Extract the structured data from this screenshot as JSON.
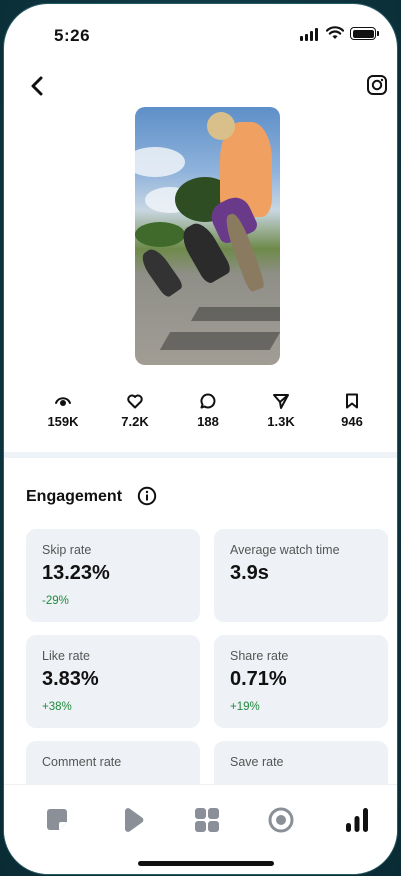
{
  "status": {
    "time": "5:26"
  },
  "header": {
    "back_icon": "chevron-left-icon",
    "platform_icon": "instagram-icon"
  },
  "stats": [
    {
      "icon": "eye-icon",
      "value": "159K"
    },
    {
      "icon": "heart-icon",
      "value": "7.2K"
    },
    {
      "icon": "comment-icon",
      "value": "188"
    },
    {
      "icon": "share-icon",
      "value": "1.3K"
    },
    {
      "icon": "bookmark-icon",
      "value": "946"
    }
  ],
  "engagement": {
    "title": "Engagement",
    "cards": [
      {
        "label": "Skip rate",
        "value": "13.23%",
        "change": "-29%"
      },
      {
        "label": "Average watch time",
        "value": "3.9s",
        "change": ""
      },
      {
        "label": "Like rate",
        "value": "3.83%",
        "change": "+38%"
      },
      {
        "label": "Share rate",
        "value": "0.71%",
        "change": "+19%"
      },
      {
        "label": "Comment rate",
        "value": "",
        "change": ""
      },
      {
        "label": "Save rate",
        "value": "",
        "change": ""
      }
    ]
  },
  "colors": {
    "positive": "#1f8a3d",
    "card_bg": "#eef1f5"
  },
  "tabbar": [
    "notes-icon",
    "play-icon",
    "grid-icon",
    "record-icon",
    "bar-chart-icon"
  ]
}
